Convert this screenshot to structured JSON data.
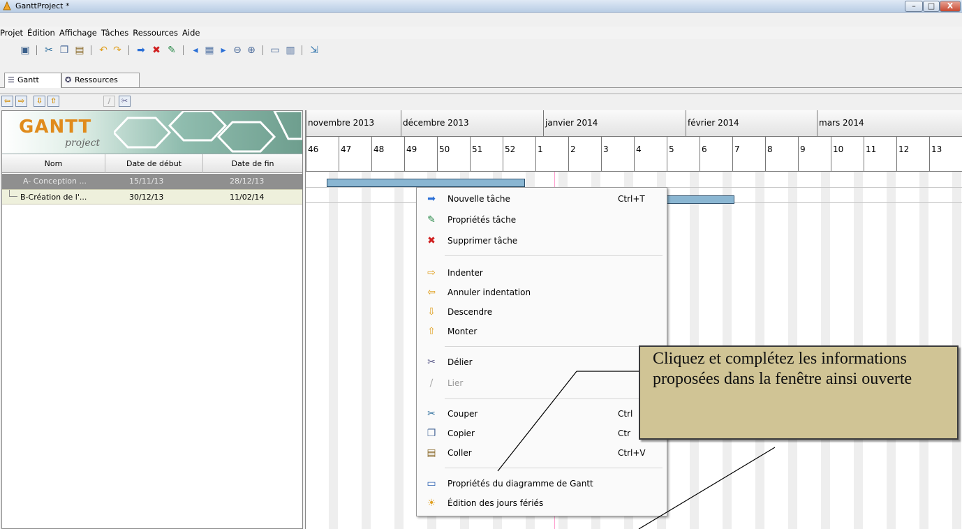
{
  "window": {
    "title": "GanttProject *",
    "min": "–",
    "max": "□",
    "close": "X"
  },
  "menu": [
    "Projet",
    "Édition",
    "Affichage",
    "Tâches",
    "Ressources",
    "Aide"
  ],
  "toolbar_icons": [
    "save-icon",
    "cut-icon",
    "copy-icon",
    "paste-icon",
    "undo-icon",
    "redo-icon",
    "new-task-icon",
    "delete-icon",
    "properties-icon",
    "scroll-left-icon",
    "grid-icon",
    "scroll-right-icon",
    "zoom-out-icon",
    "zoom-in-icon",
    "print-icon",
    "preview-icon",
    "link-icon"
  ],
  "tabs": [
    {
      "label": "Gantt",
      "icon": "gantt-icon"
    },
    {
      "label": "Ressources",
      "icon": "resources-icon"
    }
  ],
  "subtools": [
    "indent-left-icon",
    "indent-right-icon",
    "move-down-icon",
    "move-up-icon",
    "link-disabled-icon",
    "unlink-icon"
  ],
  "logo": {
    "main": "GANTT",
    "sub": "project"
  },
  "table": {
    "headers": [
      "Nom",
      "Date de début",
      "Date de fin"
    ],
    "rows": [
      {
        "name": "A- Conception ...",
        "start": "15/11/13",
        "end": "28/12/13"
      },
      {
        "name": "B-Création de l'...",
        "start": "30/12/13",
        "end": "11/02/14"
      }
    ]
  },
  "timeline": {
    "months": [
      "novembre 2013",
      "décembre 2013",
      "janvier 2014",
      "février 2014",
      "mars 2014"
    ],
    "weeks": [
      "46",
      "47",
      "48",
      "49",
      "50",
      "51",
      "52",
      "1",
      "2",
      "3",
      "4",
      "5",
      "6",
      "7",
      "8",
      "9",
      "10",
      "11",
      "12",
      "13"
    ]
  },
  "context_menu": {
    "items": [
      {
        "label": "Nouvelle tâche",
        "shortcut": "Ctrl+T",
        "icon": "new-task-icon",
        "disabled": false
      },
      {
        "label": "Propriétés tâche",
        "shortcut": "",
        "icon": "properties-icon",
        "disabled": false
      },
      {
        "label": "Supprimer tâche",
        "shortcut": "",
        "icon": "delete-icon",
        "disabled": false
      },
      {
        "label": "Indenter",
        "shortcut": "",
        "icon": "indent-icon",
        "disabled": false
      },
      {
        "label": "Annuler indentation",
        "shortcut": "",
        "icon": "unindent-icon",
        "disabled": false
      },
      {
        "label": "Descendre",
        "shortcut": "",
        "icon": "move-down-icon",
        "disabled": false
      },
      {
        "label": "Monter",
        "shortcut": "",
        "icon": "move-up-icon",
        "disabled": false
      },
      {
        "label": "Délier",
        "shortcut": "",
        "icon": "unlink-icon",
        "disabled": false
      },
      {
        "label": "Lier",
        "shortcut": "",
        "icon": "link-icon",
        "disabled": true
      },
      {
        "label": "Couper",
        "shortcut": "Ctrl",
        "icon": "cut-icon",
        "disabled": false
      },
      {
        "label": "Copier",
        "shortcut": "Ctr",
        "icon": "copy-icon",
        "disabled": false
      },
      {
        "label": "Coller",
        "shortcut": "Ctrl+V",
        "icon": "paste-icon",
        "disabled": false
      },
      {
        "label": "Propriétés du diagramme de Gantt",
        "shortcut": "",
        "icon": "monitor-icon",
        "disabled": false
      },
      {
        "label": "Édition des jours fériés",
        "shortcut": "",
        "icon": "holiday-icon",
        "disabled": false
      }
    ]
  },
  "callout": {
    "text": "Cliquez et complétez les informations proposées dans la fenêtre ainsi ouverte"
  }
}
